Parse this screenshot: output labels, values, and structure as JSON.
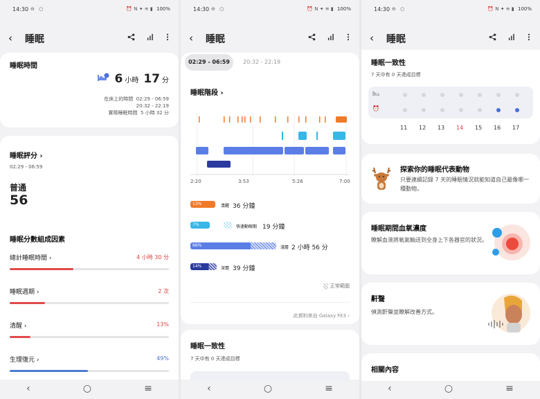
{
  "status": {
    "time": "14:30",
    "battery": "100%"
  },
  "screen1": {
    "title": "睡眠",
    "sleep_time": {
      "heading": "睡眠時間",
      "hours": "6",
      "hours_unit": "小時",
      "minutes": "17",
      "minutes_unit": "分",
      "rows": [
        {
          "label": "在床上的時間",
          "value": "02:29 - 06:59"
        },
        {
          "label": "",
          "value": "20:32 - 22:19"
        },
        {
          "label": "實際睡眠時間",
          "value": "5 小時 32 分"
        }
      ]
    },
    "score": {
      "heading": "睡眠評分",
      "range": "02:29 - 06:59",
      "quality": "普通",
      "value": "56",
      "factors_heading": "睡眠分數組成因素",
      "factors": [
        {
          "label": "總計睡眠時間",
          "value": "4 小時 30 分",
          "fill": 0.4,
          "color": "#e04a4a"
        },
        {
          "label": "睡眠週期",
          "value": "2 次",
          "fill": 0.22,
          "color": "#e04a4a"
        },
        {
          "label": "清醒",
          "value": "13%",
          "fill": 0.13,
          "color": "#e04a4a"
        },
        {
          "label": "生理復元",
          "value": "49%",
          "fill": 0.49,
          "color": "#4a7bd6"
        }
      ]
    }
  },
  "screen2": {
    "title": "睡眠",
    "tabs": [
      "02:29 - 06:59",
      "20:32 - 22:19"
    ],
    "stages_heading": "睡眠階段",
    "x_ticks": [
      "2:20",
      "3:53",
      "5:26",
      "7:00"
    ],
    "stages": [
      {
        "pct": "13%",
        "name": "清醒",
        "value": "36 分鐘",
        "color": "#f07a2a",
        "fill": 0.13
      },
      {
        "pct": "7%",
        "name": "快速動眼期",
        "value": "19 分鐘",
        "color": "#38b6e6",
        "fill": 0.07
      },
      {
        "pct": "66%",
        "name": "淺層",
        "value": "2 小時 56 分",
        "color": "#5b7ee6",
        "fill": 0.66
      },
      {
        "pct": "14%",
        "name": "深層",
        "value": "39 分鐘",
        "color": "#2b3a9e",
        "fill": 0.14
      }
    ],
    "normal_range": "正常範圍",
    "source": "此資料來自 Galaxy Fit3",
    "consistency_heading": "睡眠一致性",
    "consistency_sub": "7 天中有 0 天達成目標"
  },
  "screen3": {
    "title": "睡眠",
    "consistency_heading": "睡眠一致性",
    "consistency_sub": "7 天中有 0 天達成目標",
    "days": [
      "11",
      "12",
      "13",
      "14",
      "15",
      "16",
      "17"
    ],
    "today_color": "#e03c3c",
    "animal": {
      "title": "探索你的睡眠代表動物",
      "desc": "只要連續記錄 7 天的睡眠情況就能知道自己最像哪一種動物。"
    },
    "oxygen": {
      "title": "睡眠期間血氧濃度",
      "desc": "瞭解血液將氧氣輸送到全身上下各器官的狀況。"
    },
    "snore": {
      "title": "鼾聲",
      "desc": "偵測鼾聲並瞭解改善方式。"
    },
    "related": "相關內容"
  }
}
